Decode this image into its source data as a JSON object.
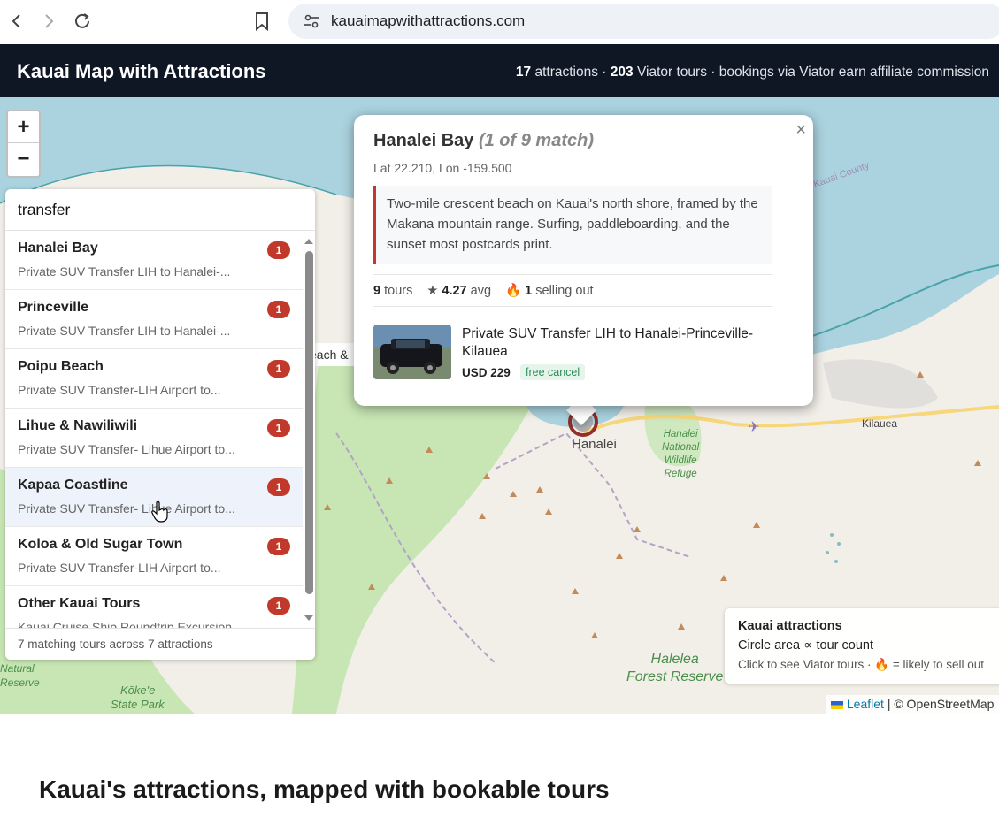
{
  "browser": {
    "url": "kauaimapwithattractions.com"
  },
  "header": {
    "title": "Kauai Map with Attractions",
    "stats_attractions_count": "17",
    "stats_attractions_label": "attractions ·",
    "stats_tours_count": "203",
    "stats_tours_label": "Viator tours · bookings via Viator earn affiliate commission"
  },
  "map": {
    "zoom_in": "+",
    "zoom_out": "−",
    "labels": {
      "hanalei": "Hanalei",
      "kilauea": "Kilauea",
      "refuge": [
        "Hanalei",
        "National",
        "Wildlife",
        "Refuge"
      ],
      "halelea": [
        "Halelea",
        "Forest Reserve"
      ],
      "kokee": [
        "Kōke'e",
        "State Park"
      ],
      "natural": [
        "Natural",
        "Reserve"
      ],
      "county": "Kauai County",
      "partial_label": "each &"
    }
  },
  "search": {
    "query": "transfer",
    "results": [
      {
        "name": "Hanalei Bay",
        "sub": "Private SUV Transfer LIH to Hanalei-...",
        "count": "1"
      },
      {
        "name": "Princeville",
        "sub": "Private SUV Transfer LIH to Hanalei-...",
        "count": "1"
      },
      {
        "name": "Poipu Beach",
        "sub": "Private SUV Transfer-LIH Airport to...",
        "count": "1"
      },
      {
        "name": "Lihue & Nawiliwili",
        "sub": "Private SUV Transfer- Lihue Airport to...",
        "count": "1"
      },
      {
        "name": "Kapaa Coastline",
        "sub": "Private SUV Transfer- Lihue Airport to...",
        "count": "1"
      },
      {
        "name": "Koloa & Old Sugar Town",
        "sub": "Private SUV Transfer-LIH Airport to...",
        "count": "1"
      },
      {
        "name": "Other Kauai Tours",
        "sub": "Kauai Cruise Ship Roundtrip Excursion",
        "count": "1"
      }
    ],
    "footer": "7 matching tours across 7 attractions"
  },
  "popup": {
    "title": "Hanalei Bay",
    "match": "(1 of 9 match)",
    "close": "×",
    "coords": "Lat 22.210, Lon -159.500",
    "description": "Two-mile crescent beach on Kauai's north shore, framed by the Makana mountain range. Surfing, paddleboarding, and the sunset most postcards print.",
    "tours_count": "9",
    "tours_label": "tours",
    "rating_star": "★",
    "rating": "4.27",
    "rating_label": "avg",
    "fire": "🔥",
    "selling_count": "1",
    "selling_label": "selling out",
    "tour_name": "Private SUV Transfer LIH to Hanalei-Princeville-Kilauea",
    "tour_price": "USD 229",
    "tour_cancel": "free cancel"
  },
  "legend": {
    "title": "Kauai attractions",
    "line1": "Circle area ∝ tour count",
    "line2": "Click to see Viator tours · 🔥 = likely to sell out"
  },
  "attribution": {
    "leaflet": "Leaflet",
    "osm": "| © OpenStreetMap"
  },
  "page": {
    "heading": "Kauai's attractions, mapped with bookable tours"
  },
  "colors": {
    "header_bg": "#0f1724",
    "badge": "#c0392b",
    "water": "#aad3df",
    "land": "#f2efe9",
    "forest": "#c8e6b4"
  }
}
